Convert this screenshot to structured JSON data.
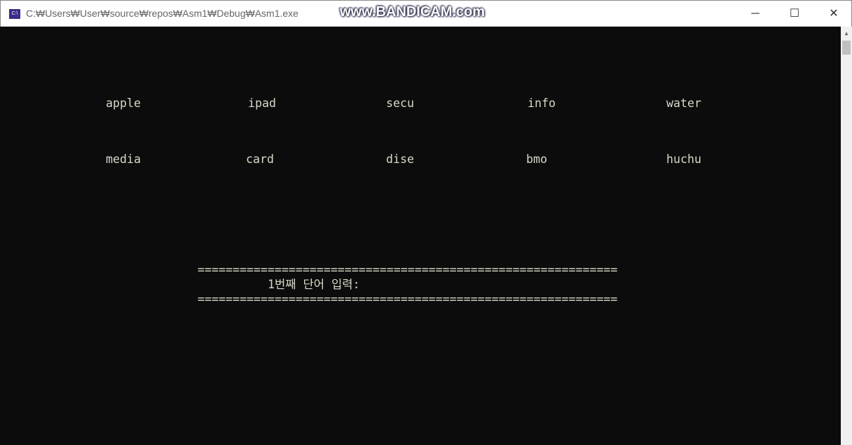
{
  "window": {
    "title": "C:₩Users₩User₩source₩repos₩Asm1₩Debug₩Asm1.exe",
    "icon_text": "C:\\",
    "watermark": "www.BANDICAM.com",
    "minimize": "─",
    "maximize": "☐",
    "close": "✕"
  },
  "words": [
    [
      "apple",
      "ipad",
      "secu",
      "info",
      "water"
    ],
    [
      "media",
      "card",
      "dise",
      "bmo",
      "huchu"
    ]
  ],
  "prompt": {
    "separator": "============================================================",
    "text": "1번째 단어 입력:"
  }
}
